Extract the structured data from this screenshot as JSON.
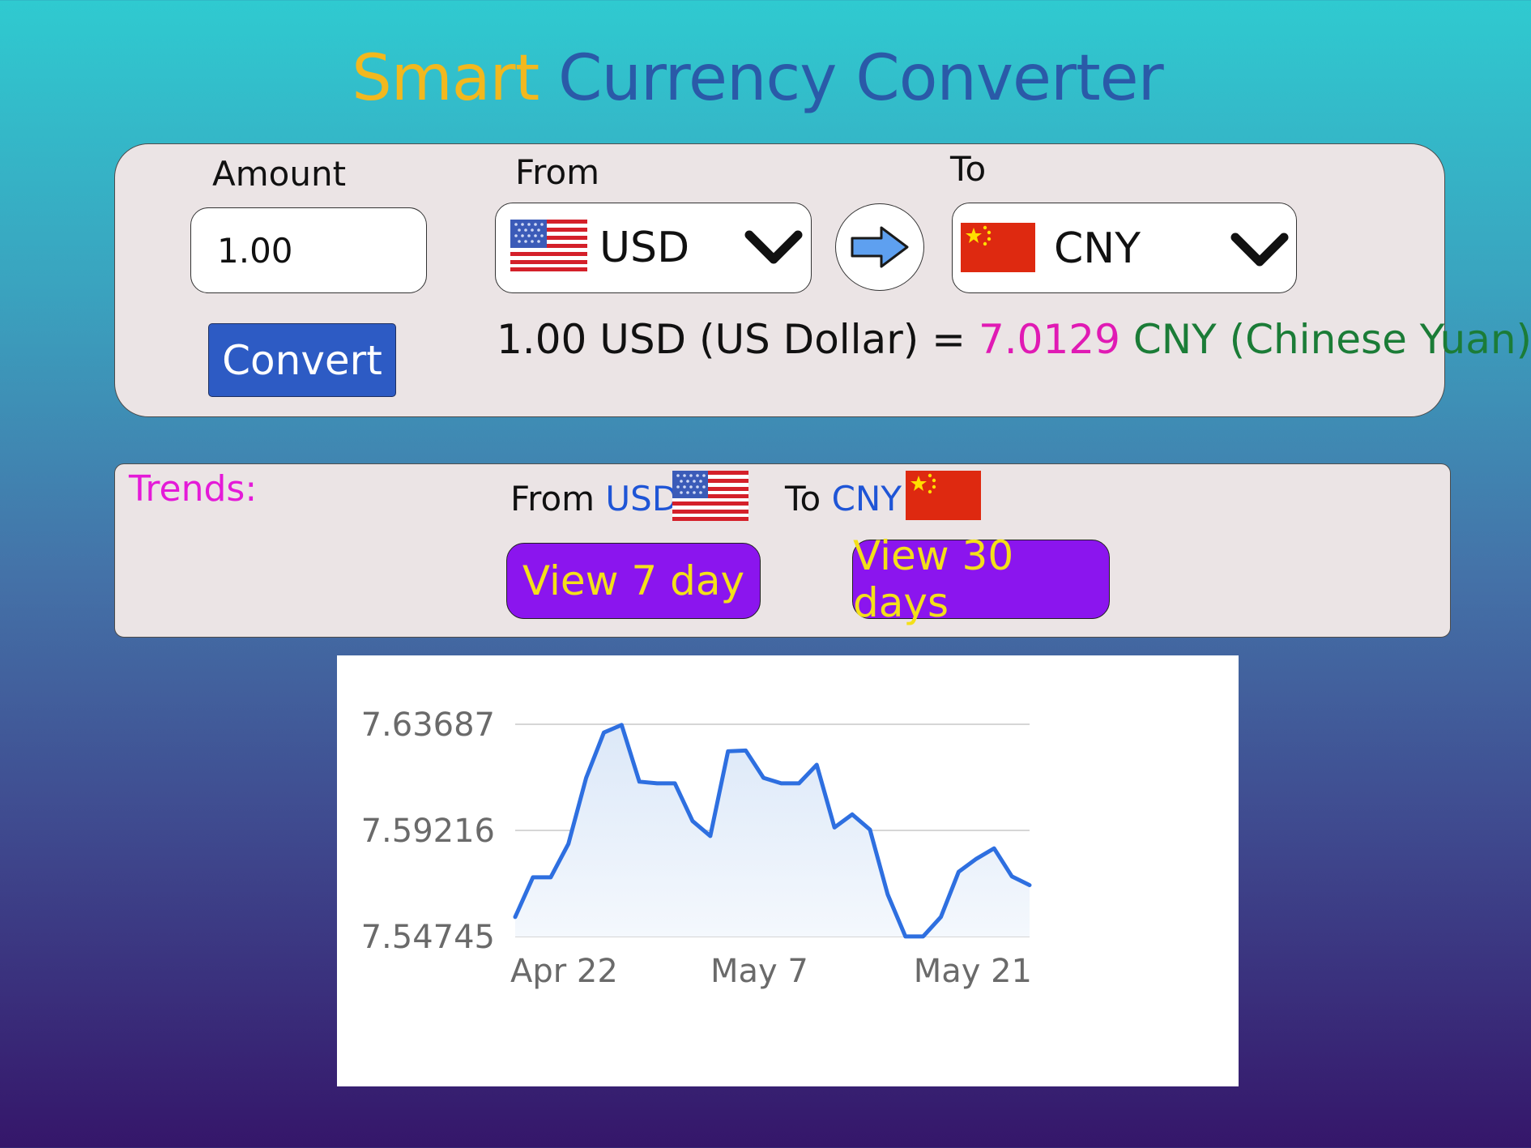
{
  "app": {
    "title_part1": "Smart",
    "title_part2": "Currency Converter",
    "title_colors": {
      "part1": "#f2b81e",
      "part2": "#2a5aa8"
    }
  },
  "converter": {
    "amount_label": "Amount",
    "amount_value": "1.00",
    "from_label": "From",
    "from_currency": "USD",
    "from_flag": "us-flag-icon",
    "to_label": "To",
    "to_currency": "CNY",
    "to_flag": "china-flag-icon",
    "swap_icon": "arrow-right-icon",
    "convert_label": "Convert",
    "result": {
      "left": "1.00 USD (US Dollar) =",
      "rate": "7.0129",
      "right": "CNY (Chinese Yuan)"
    }
  },
  "trends": {
    "label": "Trends:",
    "from_prefix": "From",
    "from_currency": "USD",
    "to_prefix": "To",
    "to_currency": "CNY",
    "view7_label": "View 7 day",
    "view30_label": "View 30 days"
  },
  "colors": {
    "accent_blue": "#2d5bc4",
    "view_button_bg": "#8b15ee",
    "view_button_text": "#f4e019",
    "rate_color": "#e01ab4",
    "to_currency_color": "#1b7c37",
    "chart_line": "#2e6fe0"
  },
  "chart_data": {
    "type": "area",
    "title": "",
    "xlabel": "",
    "ylabel": "",
    "x_tick_labels": [
      "Apr 22",
      "May 7",
      "May 21"
    ],
    "y_tick_labels": [
      "7.63687",
      "7.59216",
      "7.54745"
    ],
    "y_ticks": [
      7.63687,
      7.59216,
      7.54745
    ],
    "ylim": [
      7.54745,
      7.63687
    ],
    "grid": true,
    "legend": "none",
    "x": [
      "Apr 22",
      "Apr 23",
      "Apr 24",
      "Apr 25",
      "Apr 26",
      "Apr 27",
      "Apr 28",
      "Apr 29",
      "Apr 30",
      "May 1",
      "May 2",
      "May 3",
      "May 4",
      "May 5",
      "May 6",
      "May 7",
      "May 8",
      "May 9",
      "May 10",
      "May 11",
      "May 12",
      "May 13",
      "May 14",
      "May 15",
      "May 16",
      "May 17",
      "May 18",
      "May 19",
      "May 20",
      "May 21"
    ],
    "values": [
      7.5557,
      7.5724,
      7.5724,
      7.5865,
      7.6143,
      7.6334,
      7.6366,
      7.6127,
      7.612,
      7.612,
      7.5961,
      7.5898,
      7.6255,
      7.6258,
      7.6143,
      7.612,
      7.612,
      7.6198,
      7.5934,
      7.5989,
      7.5925,
      7.5652,
      7.5475,
      7.5475,
      7.5557,
      7.5747,
      7.5802,
      7.5846,
      7.5728,
      7.5691
    ]
  }
}
